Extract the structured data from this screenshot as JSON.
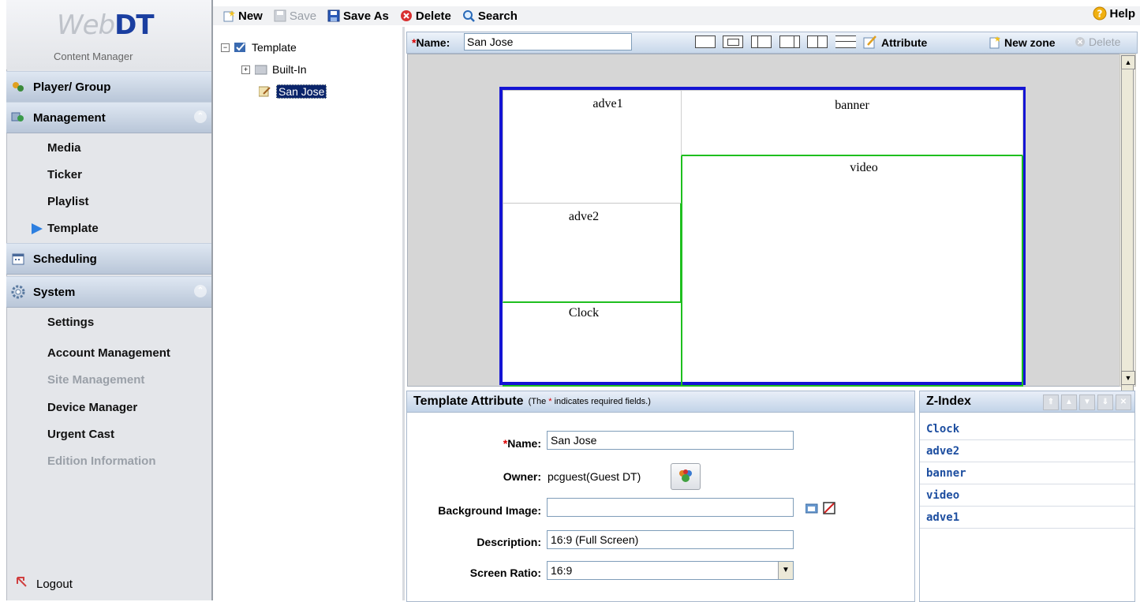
{
  "app": {
    "logo_main_light": "Web",
    "logo_main_bold": "DT",
    "logo_sub": "Content Manager"
  },
  "sidebar": {
    "sections": [
      {
        "label": "Player/ Group",
        "icon": "players-icon"
      },
      {
        "label": "Management",
        "icon": "management-icon"
      },
      {
        "label": "Scheduling",
        "icon": "calendar-icon"
      },
      {
        "label": "System",
        "icon": "gear-icon"
      }
    ],
    "management_items": [
      {
        "label": "Media",
        "disabled": false
      },
      {
        "label": "Ticker",
        "disabled": false
      },
      {
        "label": "Playlist",
        "disabled": false
      },
      {
        "label": "Template",
        "disabled": false,
        "active": true
      }
    ],
    "system_items": [
      {
        "label": "Settings",
        "disabled": false
      },
      {
        "label": "Account Management",
        "disabled": false
      },
      {
        "label": "Site Management",
        "disabled": true
      },
      {
        "label": "Device Manager",
        "disabled": false
      },
      {
        "label": "Urgent Cast",
        "disabled": false
      },
      {
        "label": "Edition Information",
        "disabled": true
      }
    ],
    "logout": "Logout"
  },
  "toolbar": {
    "new": "New",
    "save": "Save",
    "save_as": "Save As",
    "delete": "Delete",
    "search": "Search",
    "help": "Help"
  },
  "tree": {
    "root": "Template",
    "built_in": "Built-In",
    "selected": "San Jose"
  },
  "editor": {
    "name_label": "Name:",
    "name_required": "*",
    "name_value": "San Jose",
    "attribute": "Attribute",
    "new_zone": "New zone",
    "delete": "Delete"
  },
  "template_zones": {
    "adve1": "adve1",
    "banner": "banner",
    "video": "video",
    "adve2": "adve2",
    "clock": "Clock"
  },
  "attributes": {
    "title": "Template Attribute",
    "note_prefix": "(The",
    "note_star": "*",
    "note_suffix": "indicates required fields.)",
    "name_label": "Name:",
    "name_value": "San Jose",
    "owner_label": "Owner:",
    "owner_value": "pcguest(Guest DT)",
    "bg_label": "Background Image:",
    "bg_value": "",
    "desc_label": "Description:",
    "desc_value": "16:9 (Full Screen)",
    "ratio_label": "Screen Ratio:",
    "ratio_value": "16:9"
  },
  "zindex": {
    "title": "Z-Index",
    "items": [
      "Clock",
      "adve2",
      "banner",
      "video",
      "adve1"
    ]
  },
  "colors": {
    "frame_border": "#1414d4",
    "zone_border": "#1fbf1f",
    "selection": "#0a246a"
  }
}
